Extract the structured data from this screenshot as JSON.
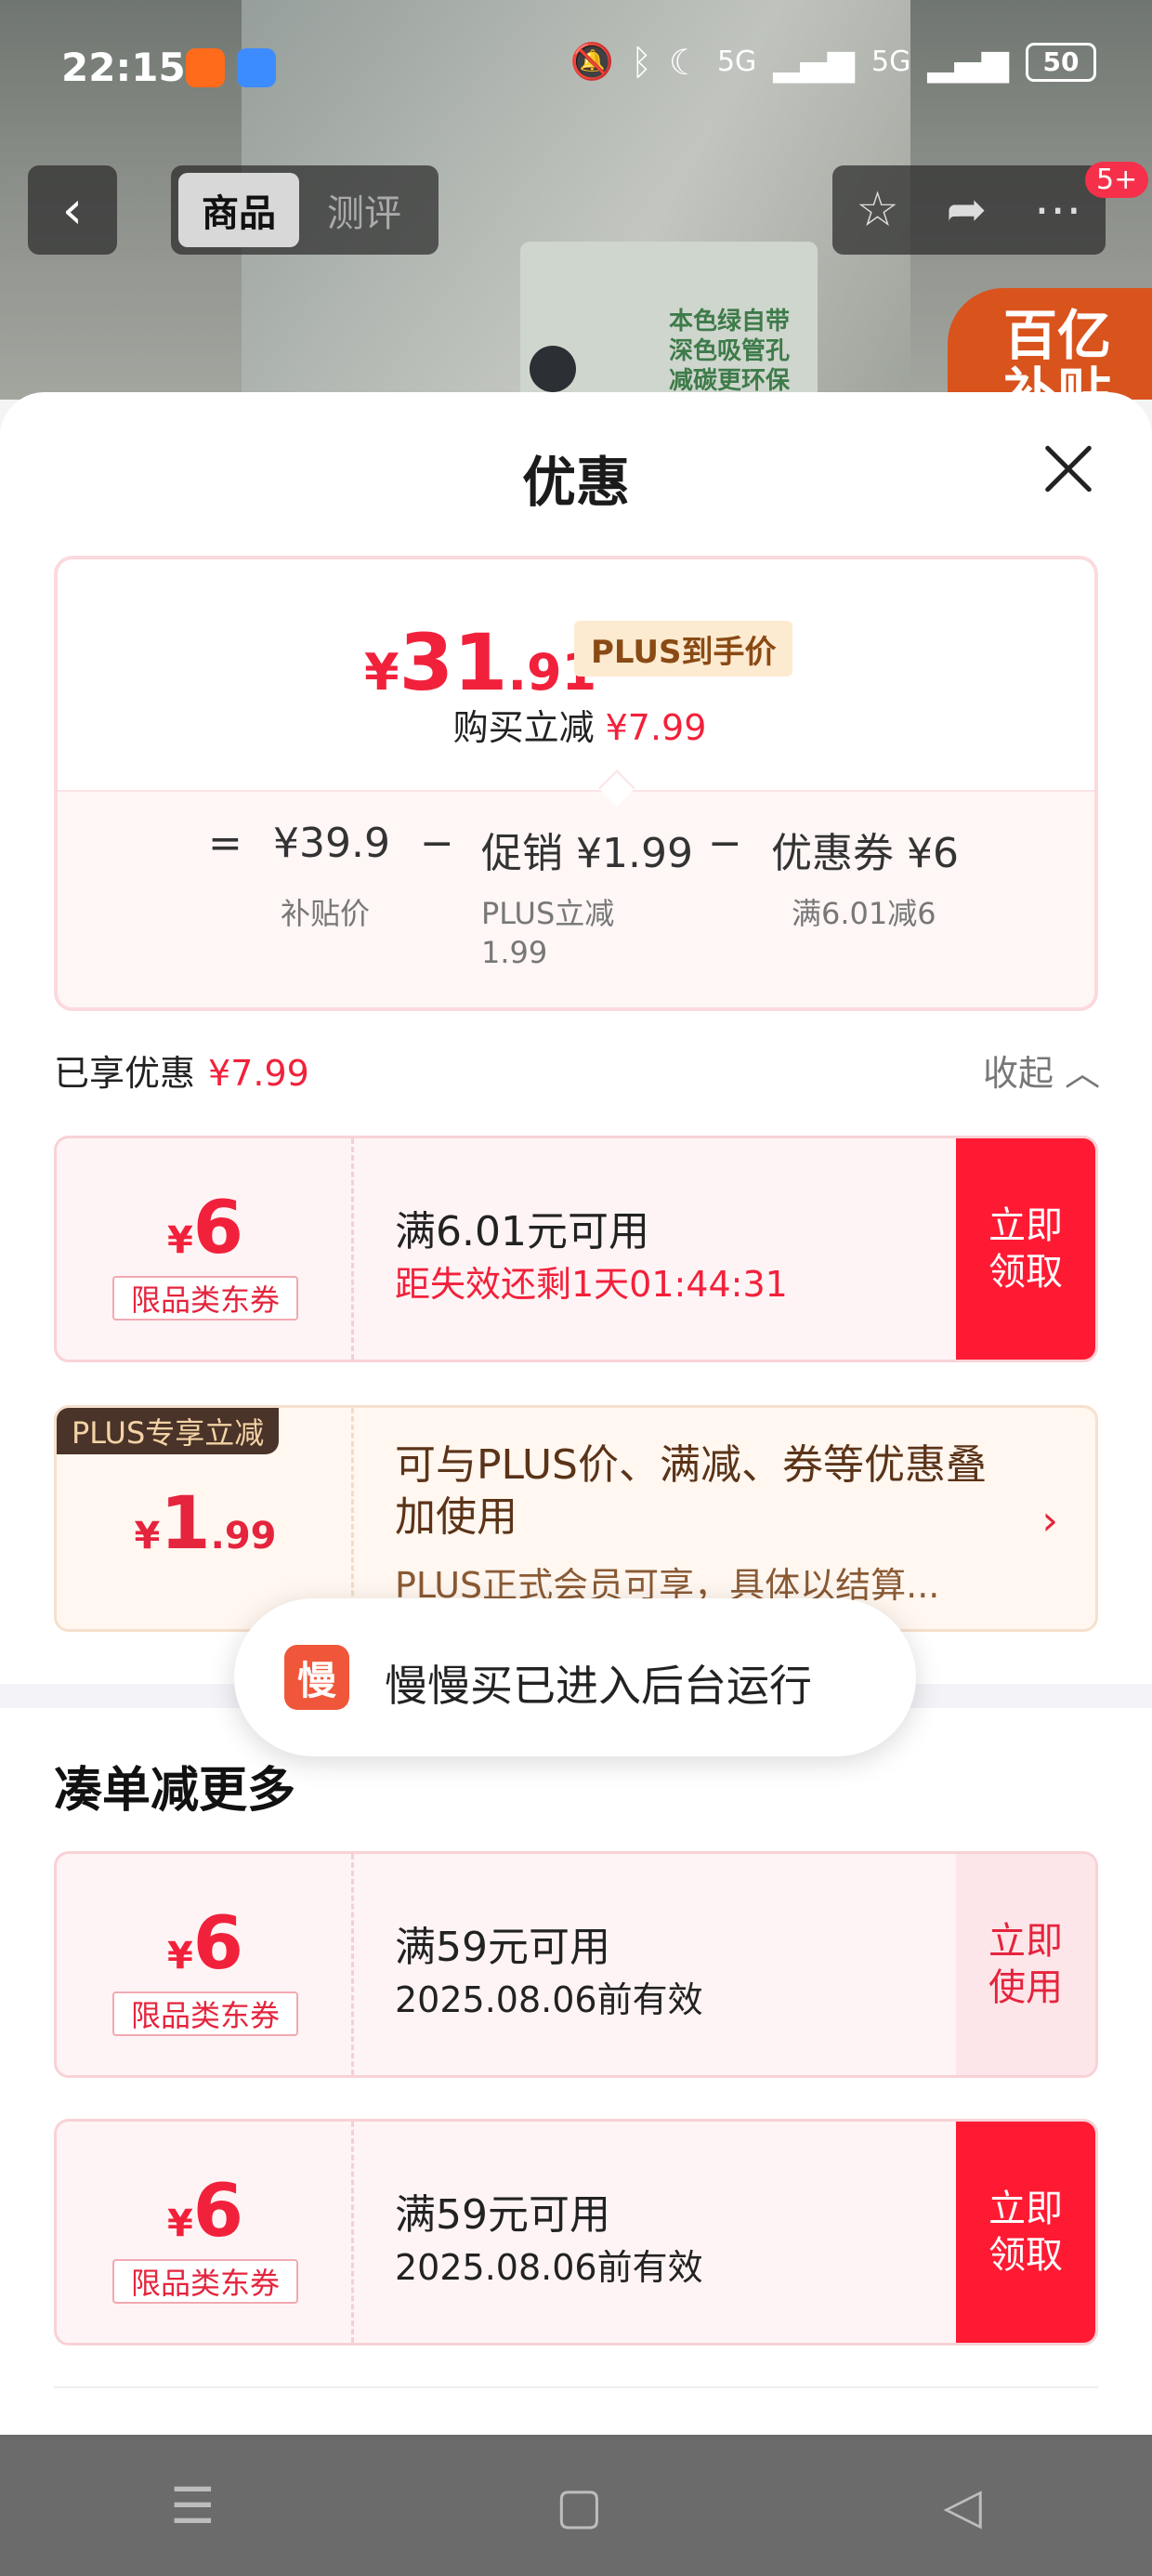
{
  "status_bar": {
    "time": "22:15",
    "battery": "50",
    "network": "5G"
  },
  "nav": {
    "tab_product": "商品",
    "tab_review": "测评",
    "badge": "5+"
  },
  "background": {
    "product_text": "本色绿自带\n深色吸管孔\n减碳更环保",
    "promo_text": "百亿\n补贴"
  },
  "sheet": {
    "title": "优惠",
    "price": {
      "currency": "¥",
      "integer": "31",
      "decimal": ".91",
      "tag": "PLUS到手价"
    },
    "buy_reduce": {
      "label": "购买立减",
      "value": "¥7.99"
    },
    "breakdown": {
      "eq": "=",
      "minus": "−",
      "subsidy": {
        "value": "¥39.9",
        "label": "补贴价"
      },
      "promo": {
        "value": "促销 ¥1.99",
        "label": "PLUS立减\n1.99"
      },
      "coupon": {
        "value": "优惠券 ¥6",
        "label": "满6.01减6"
      }
    },
    "enjoyed": {
      "label": "已享优惠",
      "value": "¥7.99",
      "collapse": "收起"
    },
    "coupon1": {
      "currency": "¥",
      "amount": "6",
      "kind": "限品类东券",
      "cond": "满6.01元可用",
      "expire": "距失效还剩1天01:44:31",
      "action": "立即\n领取"
    },
    "plus": {
      "tag": "PLUS专享立减",
      "currency": "¥",
      "amount": "1",
      "decimal": ".99",
      "title": "可与PLUS价、满减、券等优惠叠加使用",
      "desc": "PLUS正式会员可享，具体以结算..."
    },
    "more_title": "凑单减更多",
    "coupon2": {
      "currency": "¥",
      "amount": "6",
      "kind": "限品类东券",
      "cond": "满59元可用",
      "expire": "2025.08.06前有效",
      "action": "立即\n使用"
    },
    "coupon3": {
      "currency": "¥",
      "amount": "6",
      "kind": "限品类东券",
      "cond": "满59元可用",
      "expire": "2025.08.06前有效",
      "action": "立即\n领取"
    }
  },
  "toast": {
    "logo": "慢",
    "message": "慢慢买已进入后台运行"
  },
  "colors": {
    "accent_red": "#f2213b",
    "action_red": "#ff1a34",
    "plus_brown": "#4a3328"
  }
}
